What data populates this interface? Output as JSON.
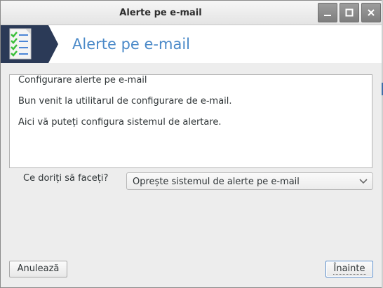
{
  "window": {
    "title": "Alerte pe e-mail"
  },
  "titlebar_buttons": {
    "minimize_icon": "minimize-icon",
    "maximize_icon": "maximize-icon",
    "close_icon": "close-icon"
  },
  "banner": {
    "title": "Alerte pe e-mail",
    "icon": "checklist-document-icon"
  },
  "content": {
    "heading": "Configurare alerte pe e-mail",
    "welcome": "Bun venit la utilitarul de configurare de e-mail.",
    "info": "Aici vă puteți configura sistemul de alertare."
  },
  "action": {
    "label": "Ce doriți să faceți?",
    "selected": "Oprește sistemul de alerte pe e-mail"
  },
  "buttons": {
    "cancel": "Anulează",
    "next": "Înainte"
  },
  "colors": {
    "banner_title": "#4a89c8",
    "banner_logo_bg": "#2b3a57",
    "focus_border": "#5c8fcb"
  }
}
